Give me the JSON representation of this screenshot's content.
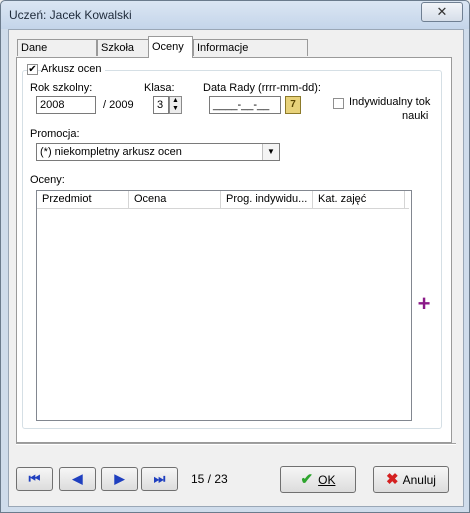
{
  "window": {
    "title": "Uczeń: Jacek Kowalski",
    "close": "✕"
  },
  "tabs": [
    {
      "label": "Dane osobowe"
    },
    {
      "label": "Szkoła"
    },
    {
      "label": "Oceny"
    },
    {
      "label": "Informacje dodatkowe"
    }
  ],
  "arkusz": {
    "checkbox_label": "Arkusz ocen",
    "checked": "✓",
    "rok_label": "Rok szkolny:",
    "rok_value": "2008",
    "rok_end": "/ 2009",
    "klasa_label": "Klasa:",
    "klasa_value": "3",
    "data_label": "Data Rady (rrrr-mm-dd):",
    "data_value": "____-__-__",
    "indywidualny_label_1": "Indywidualny tok",
    "indywidualny_label_2": "nauki",
    "promocja_label": "Promocja:",
    "promocja_value": "(*) niekompletny arkusz ocen",
    "oceny_label": "Oceny:"
  },
  "grid": {
    "columns": [
      "Przedmiot",
      "Ocena",
      "Prog. indywidu...",
      "Kat. zajęć"
    ]
  },
  "icons": {
    "first": "⏮",
    "prev": "◀",
    "next": "▶",
    "last": "⏭",
    "add": "+",
    "ok": "✔",
    "cancel": "✖",
    "calendar": "7"
  },
  "nav": {
    "counter": "15 / 23"
  },
  "buttons": {
    "ok": "OK",
    "cancel": "Anuluj"
  }
}
